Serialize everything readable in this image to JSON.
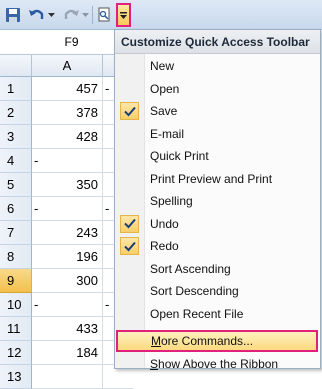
{
  "name_box": "F9",
  "qat": {
    "buttons": [
      "save-icon",
      "undo-icon",
      "redo-icon",
      "print-preview-icon",
      "customize-dropdown-icon"
    ]
  },
  "columns": [
    "A"
  ],
  "rows": [
    {
      "num": "1",
      "a": "457",
      "b": "-"
    },
    {
      "num": "2",
      "a": "378",
      "b": ""
    },
    {
      "num": "3",
      "a": "428",
      "b": ""
    },
    {
      "num": "4",
      "a": "-",
      "b": ""
    },
    {
      "num": "5",
      "a": "350",
      "b": ""
    },
    {
      "num": "6",
      "a": "-",
      "b": "-"
    },
    {
      "num": "7",
      "a": "243",
      "b": ""
    },
    {
      "num": "8",
      "a": "196",
      "b": ""
    },
    {
      "num": "9",
      "a": "300",
      "b": ""
    },
    {
      "num": "10",
      "a": "-",
      "b": "-"
    },
    {
      "num": "11",
      "a": "433",
      "b": ""
    },
    {
      "num": "12",
      "a": "184",
      "b": ""
    },
    {
      "num": "13",
      "a": "",
      "b": ""
    }
  ],
  "selected_row": "9",
  "menu": {
    "title": "Customize Quick Access Toolbar",
    "items": [
      {
        "label": "New",
        "checked": false
      },
      {
        "label": "Open",
        "checked": false
      },
      {
        "label": "Save",
        "checked": true
      },
      {
        "label": "E-mail",
        "checked": false
      },
      {
        "label": "Quick Print",
        "checked": false
      },
      {
        "label": "Print Preview and Print",
        "checked": false
      },
      {
        "label": "Spelling",
        "checked": false
      },
      {
        "label": "Undo",
        "checked": true
      },
      {
        "label": "Redo",
        "checked": true
      },
      {
        "label": "Sort Ascending",
        "checked": false
      },
      {
        "label": "Sort Descending",
        "checked": false
      },
      {
        "label": "Open Recent File",
        "checked": false
      },
      {
        "label": "More Commands...",
        "checked": false
      },
      {
        "label": "Show Above the Ribbon",
        "checked": false
      }
    ],
    "more_commands_underline": "M",
    "more_commands_rest": "ore Commands...",
    "show_above_underline": "S",
    "show_above_rest": "how Above the Ribbon"
  },
  "colors": {
    "highlight_border": "#e0207a",
    "check_bg": "#f7cf69",
    "toolbar_bg": "#c7d8ed"
  }
}
